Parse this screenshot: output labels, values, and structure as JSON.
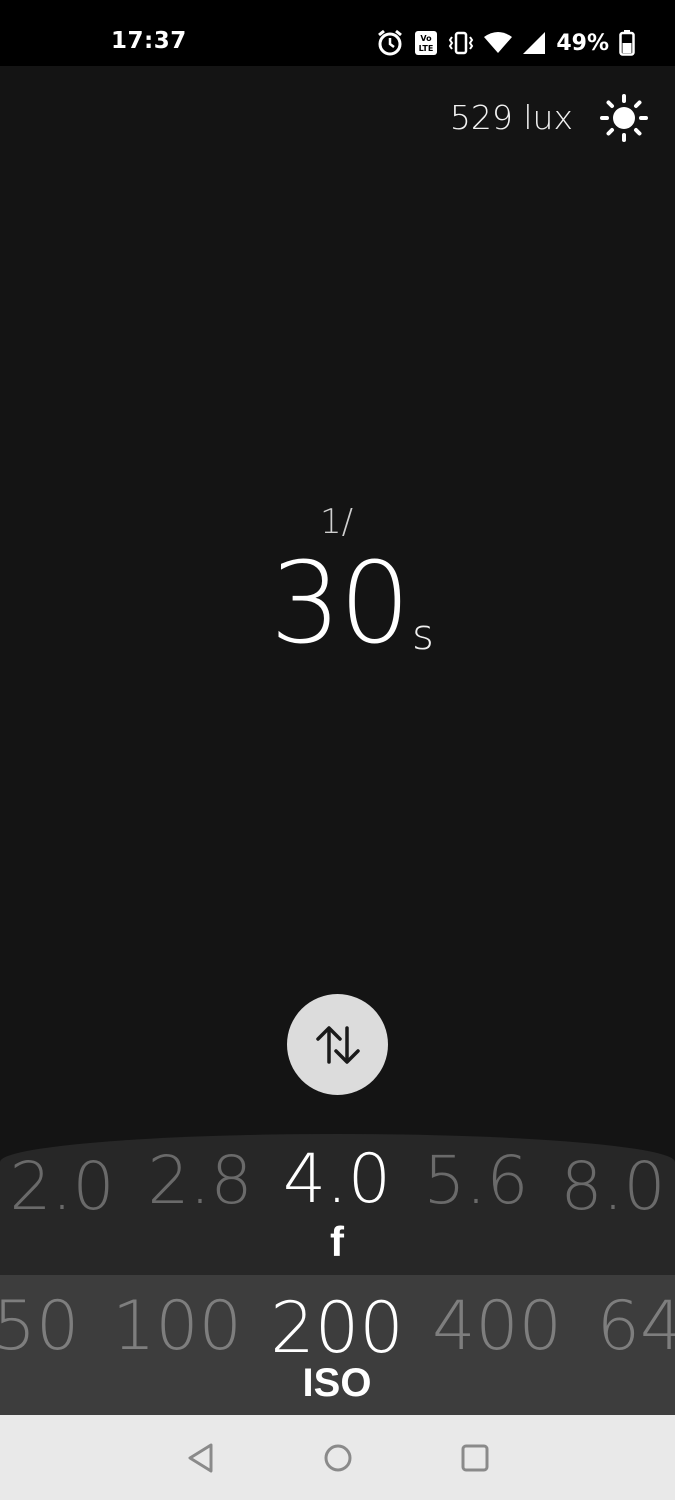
{
  "status_bar": {
    "time": "17:37",
    "battery_percent": "49%",
    "icons": [
      "alarm-icon",
      "volte-icon",
      "vibrate-icon",
      "wifi-icon",
      "signal-icon",
      "battery-icon"
    ]
  },
  "meter": {
    "lux_reading": "529 lux",
    "sensor_icon": "sun-icon"
  },
  "shutter": {
    "prefix": "1/",
    "value": "30",
    "unit": "s"
  },
  "swap_button": {
    "icon": "swap-vertical-icon"
  },
  "aperture": {
    "label": "f",
    "values": [
      "2.0",
      "2.8",
      "4.0",
      "5.6",
      "8.0"
    ],
    "selected": "4.0"
  },
  "iso": {
    "label": "ISO",
    "values": [
      "50",
      "100",
      "200",
      "400",
      "64"
    ],
    "selected": "200"
  },
  "nav": {
    "buttons": [
      "back-icon",
      "home-icon",
      "recents-icon"
    ]
  },
  "colors": {
    "background": "#141414",
    "status_bar": "#000000",
    "aperture_dial": "#272727",
    "iso_dial": "#3d3d3d",
    "nav_bar": "#e9e9e9",
    "swap_button": "#dcdcdc"
  }
}
